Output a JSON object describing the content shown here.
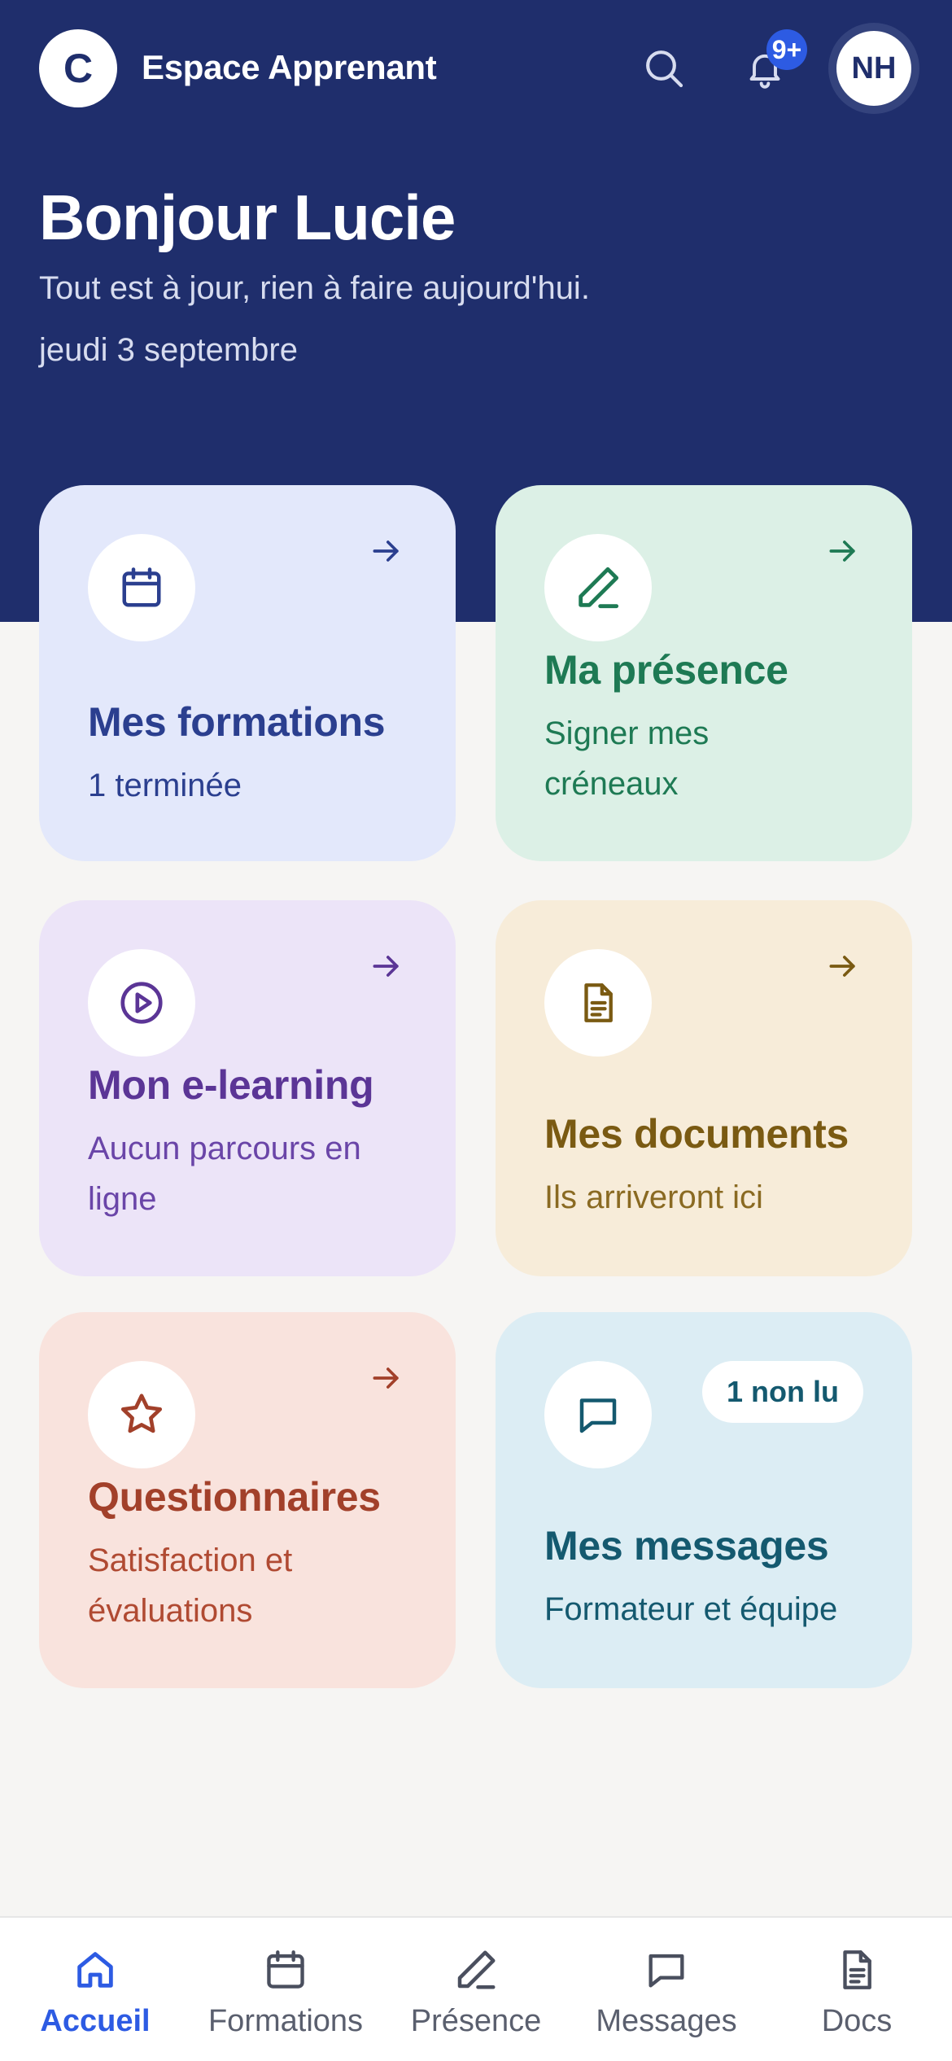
{
  "header": {
    "logo_letter": "C",
    "app_title": "Espace Apprenant",
    "notifications_badge": "9+",
    "avatar_initials": "NH"
  },
  "hero": {
    "greeting": "Bonjour Lucie",
    "status": "Tout est à jour, rien à faire aujourd'hui.",
    "date": "jeudi 3 septembre"
  },
  "cards": [
    {
      "title": "Mes formations",
      "subtitle": "1 terminée",
      "icon": "calendar-icon",
      "accent": "#2b3f8f",
      "has_arrow": true
    },
    {
      "title": "Ma présence",
      "subtitle": "Signer mes créneaux",
      "icon": "pencil-icon",
      "accent": "#1e7a54",
      "has_arrow": true
    },
    {
      "title": "Mon e-learning",
      "subtitle": "Aucun parcours en ligne",
      "icon": "play-circle-icon",
      "accent": "#5b3596",
      "has_arrow": true
    },
    {
      "title": "Mes documents",
      "subtitle": "Ils arriveront ici",
      "icon": "document-icon",
      "accent": "#7a5a12",
      "has_arrow": true
    },
    {
      "title": "Questionnaires",
      "subtitle": "Satisfaction et évaluations",
      "icon": "star-icon",
      "accent": "#a2402a",
      "has_arrow": true
    },
    {
      "title": "Mes messages",
      "subtitle": "Formateur et équipe",
      "icon": "chat-icon",
      "accent": "#14596f",
      "badge": "1 non lu",
      "has_arrow": false
    }
  ],
  "bottom_nav": [
    {
      "label": "Accueil",
      "icon": "home-icon",
      "active": true
    },
    {
      "label": "Formations",
      "icon": "calendar-icon",
      "active": false
    },
    {
      "label": "Présence",
      "icon": "pencil-icon",
      "active": false
    },
    {
      "label": "Messages",
      "icon": "chat-icon",
      "active": false
    },
    {
      "label": "Docs",
      "icon": "document-icon",
      "active": false
    }
  ],
  "colors": {
    "hero_bg": "#1f2e6c",
    "page_bg": "#f6f5f3",
    "active_nav": "#2d5be3",
    "badge_bg": "#2d5be3"
  }
}
